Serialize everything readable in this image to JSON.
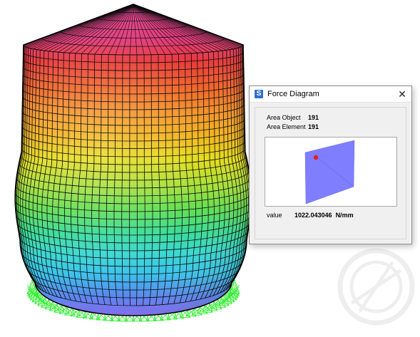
{
  "dialog": {
    "title": "Force Diagram",
    "app_icon_letter": "S",
    "close_symbol": "✕",
    "area_object_label": "Area Object",
    "area_object_value": "191",
    "area_element_label": "Area Element",
    "area_element_value": "191",
    "value_label": "value",
    "value": "1022.043046",
    "unit": "N/mm"
  },
  "colors": {
    "element_fill": "#7e7eff",
    "marker": "#e02020",
    "support": "#33ee33",
    "mesh_line": "#0a0a0a"
  }
}
